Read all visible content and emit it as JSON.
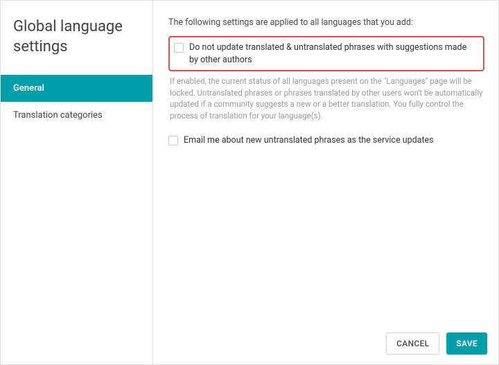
{
  "title": "Global language settings",
  "sidebar": {
    "items": [
      {
        "label": "General",
        "active": true
      },
      {
        "label": "Translation categories",
        "active": false
      }
    ]
  },
  "content": {
    "intro": "The following settings are applied to all languages that you add:",
    "settings": [
      {
        "label": "Do not update translated & untranslated phrases with suggestions made by other authors",
        "helper": "If enabled, the current status of all languages present on the \"Languages\" page will be locked. Untranslated phrases or phrases translated by other users won't be automatically updated if a community suggests a new or a better translation. You fully control the process of translation for your language(s).",
        "highlighted": true,
        "checked": false
      },
      {
        "label": "Email me about new untranslated phrases as the service updates",
        "helper": "",
        "highlighted": false,
        "checked": false
      }
    ]
  },
  "footer": {
    "cancel": "CANCEL",
    "save": "SAVE"
  }
}
